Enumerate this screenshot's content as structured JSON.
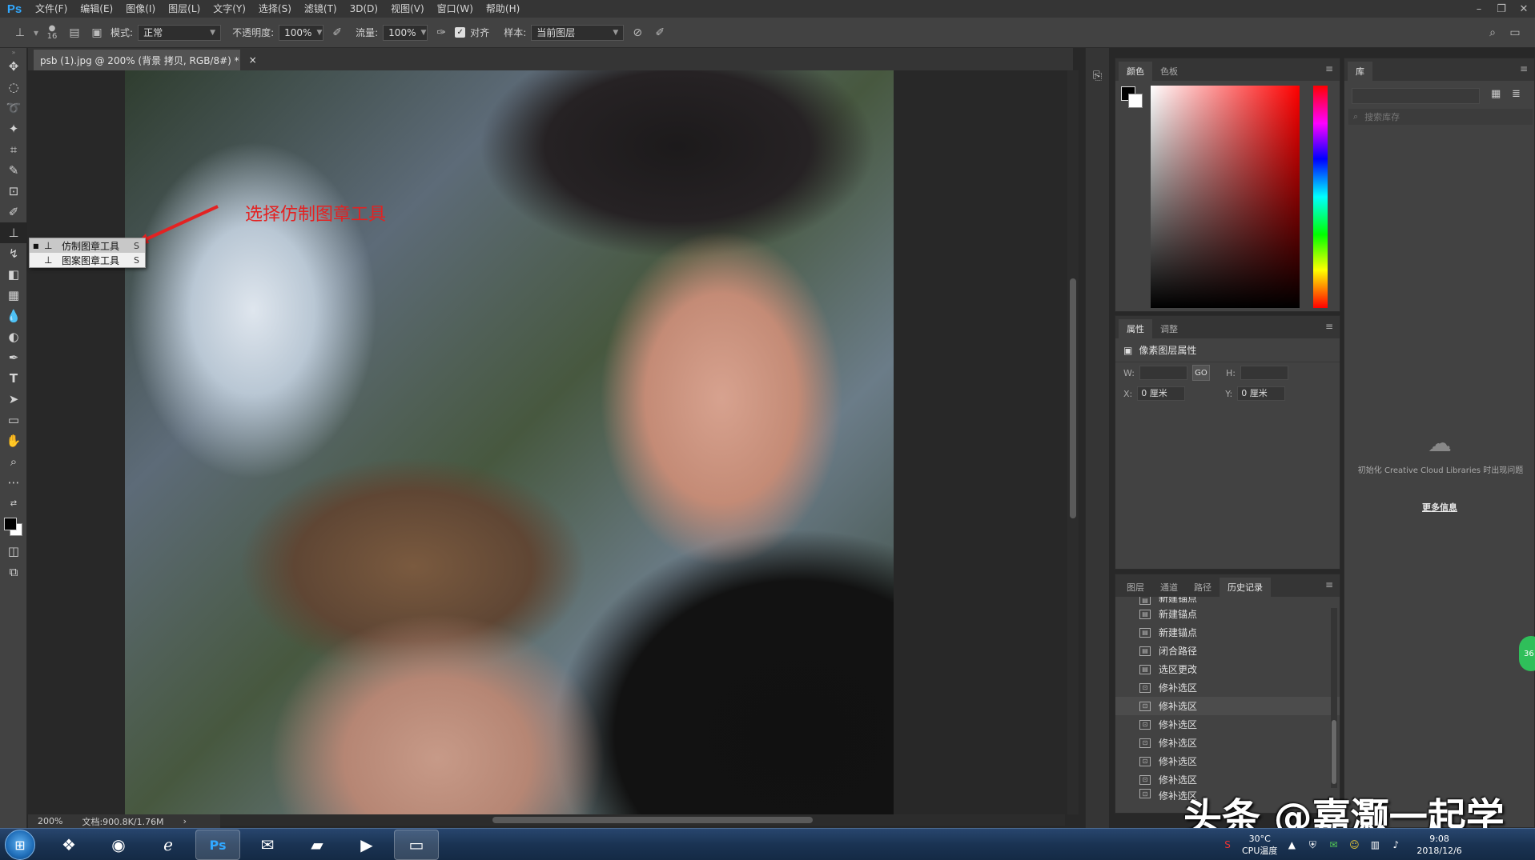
{
  "app": {
    "logo": "Ps",
    "document_tab": "psb (1).jpg @ 200% (背景 拷贝, RGB/8#) *",
    "tab_close": "×"
  },
  "menu": [
    "文件(F)",
    "编辑(E)",
    "图像(I)",
    "图层(L)",
    "文字(Y)",
    "选择(S)",
    "滤镜(T)",
    "3D(D)",
    "视图(V)",
    "窗口(W)",
    "帮助(H)"
  ],
  "window_controls": {
    "minimize": "–",
    "restore": "❐",
    "close": "✕"
  },
  "options_bar": {
    "brush_size": "16",
    "mode_label": "模式:",
    "mode_value": "正常",
    "opacity_label": "不透明度:",
    "opacity_value": "100%",
    "flow_label": "流量:",
    "flow_value": "100%",
    "align_label": "对齐",
    "sample_label": "样本:",
    "sample_value": "当前图层"
  },
  "flyout": {
    "items": [
      {
        "label": "仿制图章工具",
        "key": "S",
        "icon": "clone-stamp-icon"
      },
      {
        "label": "图案图章工具",
        "key": "S",
        "icon": "pattern-stamp-icon"
      }
    ]
  },
  "annotation": {
    "text": "选择仿制图章工具",
    "color": "#e32222"
  },
  "status": {
    "zoom": "200%",
    "doc_size": "文档:900.8K/1.76M",
    "arrow": "›"
  },
  "color_panel": {
    "tabs": [
      "颜色",
      "色板"
    ],
    "active_tab": "颜色",
    "foreground": "#000000",
    "background": "#ffffff"
  },
  "properties_panel": {
    "tabs": [
      "属性",
      "调整"
    ],
    "title": "像素图层属性",
    "w_label": "W:",
    "w_value": "",
    "h_label": "H:",
    "h_value": "",
    "x_label": "X:",
    "x_value": "0 厘米",
    "y_label": "Y:",
    "y_value": "0 厘米",
    "link": "GO"
  },
  "history_panel": {
    "tabs": [
      "图层",
      "通道",
      "路径",
      "历史记录"
    ],
    "active_tab": "历史记录",
    "items": [
      {
        "label": "新建锚点",
        "icon": "history-doc-icon"
      },
      {
        "label": "新建锚点",
        "icon": "history-doc-icon"
      },
      {
        "label": "新建锚点",
        "icon": "history-doc-icon"
      },
      {
        "label": "闭合路径",
        "icon": "history-doc-icon"
      },
      {
        "label": "选区更改",
        "icon": "history-doc-icon"
      },
      {
        "label": "修补选区",
        "icon": "history-patch-icon"
      },
      {
        "label": "修补选区",
        "icon": "history-patch-icon",
        "highlighted": true
      },
      {
        "label": "修补选区",
        "icon": "history-patch-icon"
      },
      {
        "label": "修补选区",
        "icon": "history-patch-icon"
      },
      {
        "label": "修补选区",
        "icon": "history-patch-icon"
      },
      {
        "label": "修补选区",
        "icon": "history-patch-icon"
      },
      {
        "label": "修补选区",
        "icon": "history-patch-icon"
      }
    ]
  },
  "library_panel": {
    "tab": "库",
    "search_placeholder": "搜索库存",
    "message": "初始化 Creative Cloud Libraries 时出现问题",
    "more_link": "更多信息"
  },
  "badge": {
    "text": "36"
  },
  "watermark": "头条 @嘉灏一起学",
  "taskbar": {
    "apps": [
      {
        "name": "windows-logo-icon",
        "glyph": "⊞"
      },
      {
        "name": "browser-icon",
        "glyph": "◉"
      },
      {
        "name": "ie-icon",
        "glyph": "e"
      },
      {
        "name": "photoshop-icon",
        "glyph": "Ps",
        "active": true
      },
      {
        "name": "wechat-icon",
        "glyph": "✉"
      },
      {
        "name": "folder-icon",
        "glyph": "🗀"
      },
      {
        "name": "media-icon",
        "glyph": "▶"
      },
      {
        "name": "screenshot-icon",
        "glyph": "▭"
      }
    ],
    "temp": "30°C",
    "cpu_label": "CPU温度",
    "time": "9:08",
    "date": "2018/12/6",
    "tray_show": "▲"
  }
}
